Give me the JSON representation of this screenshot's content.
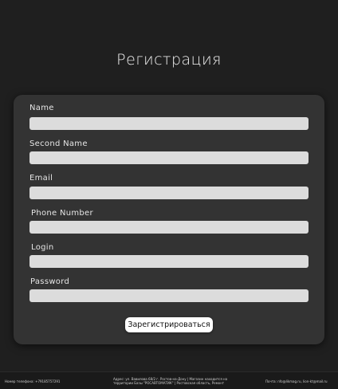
{
  "page": {
    "title": "Регистрация"
  },
  "form": {
    "fields": [
      {
        "label": "Name",
        "value": ""
      },
      {
        "label": "Second Name",
        "value": ""
      },
      {
        "label": "Email",
        "value": ""
      },
      {
        "label": "Phone Number",
        "value": ""
      },
      {
        "label": "Login",
        "value": ""
      },
      {
        "label": "Password",
        "value": ""
      }
    ],
    "submit_label": "Зарегистрироваться"
  },
  "footer": {
    "phone": "Номер телефона: +79185757291",
    "address": "Адрес: ул. Вавилова 68/2 г. Ростов-на-Дону | Магазин находится на территории Базы \"РОСАВТОМАТИК\" | Ростовская область, Ремонт",
    "mail": "Почта: nfo@likmag.ru, lion-kt@mail.ru"
  },
  "colors": {
    "background": "#1f1f1f",
    "card": "#333333",
    "input": "#dcdcdc",
    "button": "#ffffff"
  }
}
